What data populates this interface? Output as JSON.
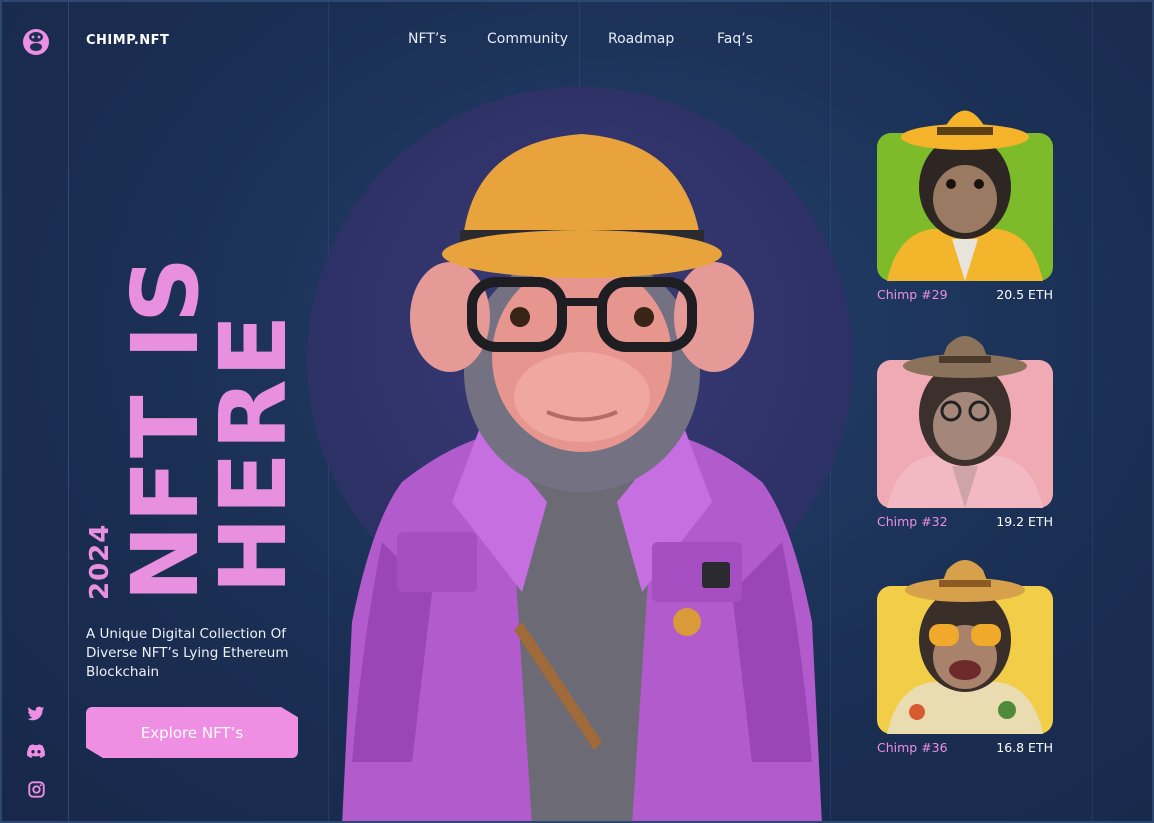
{
  "brand": {
    "name": "CHIMP.NFT"
  },
  "nav": {
    "items": [
      "NFT’s",
      "Community",
      "Roadmap",
      "Faq’s"
    ]
  },
  "hero": {
    "title_line1": "NFT IS",
    "title_line2": "HERE",
    "year": "2024",
    "tagline": "A Unique Digital Collection Of Diverse NFT’s Lying Ethereum Blockchain",
    "cta_label": "Explore NFT’s"
  },
  "social": {
    "icons": [
      "twitter-icon",
      "discord-icon",
      "instagram-icon"
    ]
  },
  "cards": [
    {
      "name": "Chimp #29",
      "price": "20.5 ETH",
      "bg": "#7dbb2a",
      "hat": "#f4b328",
      "outfit": "#f2b52b"
    },
    {
      "name": "Chimp #32",
      "price": "19.2 ETH",
      "bg": "#f0aab3",
      "hat": "#8a735a",
      "outfit": "#f2b9c2"
    },
    {
      "name": "Chimp #36",
      "price": "16.8 ETH",
      "bg": "#f2cd48",
      "hat": "#d6a14a",
      "outfit": "#e9dcb0"
    }
  ],
  "colors": {
    "accent": "#ee8fe4",
    "background": "#1c3056"
  }
}
